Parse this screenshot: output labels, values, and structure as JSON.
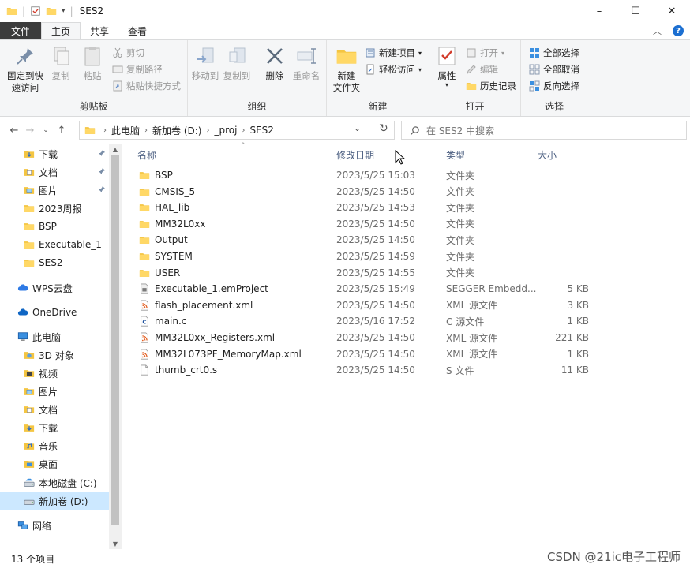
{
  "window": {
    "title": "SES2",
    "minimize": "–",
    "maximize": "☐",
    "close": "✕"
  },
  "ribbon_tabs": {
    "file": "文件",
    "home": "主页",
    "share": "共享",
    "view": "查看"
  },
  "ribbon": {
    "clipboard": {
      "label": "剪贴板",
      "pin_quick_access": "固定到快\n速访问",
      "copy": "复制",
      "paste": "粘贴",
      "cut": "剪切",
      "copy_path": "复制路径",
      "paste_shortcut": "粘贴快捷方式"
    },
    "organize": {
      "label": "组织",
      "move_to": "移动到",
      "copy_to": "复制到",
      "delete": "删除",
      "rename": "重命名"
    },
    "new": {
      "label": "新建",
      "new_folder": "新建\n文件夹",
      "new_item": "新建项目",
      "easy_access": "轻松访问"
    },
    "open": {
      "label": "打开",
      "properties": "属性",
      "open": "打开",
      "edit": "编辑",
      "history": "历史记录"
    },
    "select": {
      "label": "选择",
      "select_all": "全部选择",
      "select_none": "全部取消",
      "invert": "反向选择"
    }
  },
  "address": {
    "crumbs": [
      "此电脑",
      "新加卷 (D:)",
      "_proj",
      "SES2"
    ],
    "search_placeholder": "在 SES2 中搜索"
  },
  "nav_pane": {
    "items": [
      {
        "label": "下载",
        "icon": "download-icon",
        "pinned": true
      },
      {
        "label": "文档",
        "icon": "document-icon",
        "pinned": true
      },
      {
        "label": "图片",
        "icon": "picture-icon",
        "pinned": true
      },
      {
        "label": "2023周报",
        "icon": "folder-icon"
      },
      {
        "label": "BSP",
        "icon": "folder-icon"
      },
      {
        "label": "Executable_1",
        "icon": "folder-icon"
      },
      {
        "label": "SES2",
        "icon": "folder-icon"
      },
      {
        "label": "WPS云盘",
        "icon": "wps-cloud-icon"
      },
      {
        "label": "OneDrive",
        "icon": "onedrive-icon"
      },
      {
        "label": "此电脑",
        "icon": "pc-icon"
      },
      {
        "label": "3D 对象",
        "icon": "3d-objects-icon"
      },
      {
        "label": "视频",
        "icon": "video-icon"
      },
      {
        "label": "图片",
        "icon": "picture-icon"
      },
      {
        "label": "文档",
        "icon": "document-icon"
      },
      {
        "label": "下载",
        "icon": "download-icon"
      },
      {
        "label": "音乐",
        "icon": "music-icon"
      },
      {
        "label": "桌面",
        "icon": "desktop-icon"
      },
      {
        "label": "本地磁盘 (C:)",
        "icon": "local-disk-icon"
      },
      {
        "label": "新加卷 (D:)",
        "icon": "drive-icon",
        "selected": true
      },
      {
        "label": "网络",
        "icon": "network-icon"
      }
    ]
  },
  "columns": {
    "name": "名称",
    "modified": "修改日期",
    "type": "类型",
    "size": "大小"
  },
  "files": [
    {
      "name": "BSP",
      "date": "2023/5/25 15:03",
      "type": "文件夹",
      "size": "",
      "icon": "folder-icon"
    },
    {
      "name": "CMSIS_5",
      "date": "2023/5/25 14:50",
      "type": "文件夹",
      "size": "",
      "icon": "folder-icon"
    },
    {
      "name": "HAL_lib",
      "date": "2023/5/25 14:53",
      "type": "文件夹",
      "size": "",
      "icon": "folder-icon"
    },
    {
      "name": "MM32L0xx",
      "date": "2023/5/25 14:50",
      "type": "文件夹",
      "size": "",
      "icon": "folder-icon"
    },
    {
      "name": "Output",
      "date": "2023/5/25 14:50",
      "type": "文件夹",
      "size": "",
      "icon": "folder-icon"
    },
    {
      "name": "SYSTEM",
      "date": "2023/5/25 14:59",
      "type": "文件夹",
      "size": "",
      "icon": "folder-icon"
    },
    {
      "name": "USER",
      "date": "2023/5/25 14:55",
      "type": "文件夹",
      "size": "",
      "icon": "folder-icon"
    },
    {
      "name": "Executable_1.emProject",
      "date": "2023/5/25 15:49",
      "type": "SEGGER Embedd...",
      "size": "5 KB",
      "icon": "emproject-file-icon"
    },
    {
      "name": "flash_placement.xml",
      "date": "2023/5/25 14:50",
      "type": "XML 源文件",
      "size": "3 KB",
      "icon": "xml-file-icon"
    },
    {
      "name": "main.c",
      "date": "2023/5/16 17:52",
      "type": "C 源文件",
      "size": "1 KB",
      "icon": "c-file-icon"
    },
    {
      "name": "MM32L0xx_Registers.xml",
      "date": "2023/5/25 14:50",
      "type": "XML 源文件",
      "size": "221 KB",
      "icon": "xml-file-icon"
    },
    {
      "name": "MM32L073PF_MemoryMap.xml",
      "date": "2023/5/25 14:50",
      "type": "XML 源文件",
      "size": "1 KB",
      "icon": "xml-file-icon"
    },
    {
      "name": "thumb_crt0.s",
      "date": "2023/5/25 14:50",
      "type": "S 文件",
      "size": "11 KB",
      "icon": "s-file-icon"
    }
  ],
  "status": {
    "item_count": "13 个项目"
  },
  "watermark": "CSDN @21ic电子工程师",
  "colors": {
    "folder": "#f4c542",
    "accent": "#1c6fd1",
    "selected": "#cce8ff",
    "file_tab": "#3c3c3c"
  }
}
